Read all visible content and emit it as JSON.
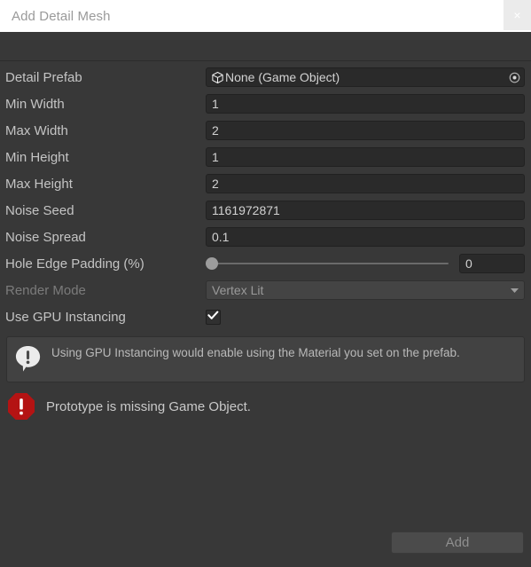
{
  "window": {
    "title": "Add Detail Mesh",
    "close_icon": "close-icon",
    "close_glyph": "×"
  },
  "colors": {
    "titlebar_bg": "#ffffff",
    "body_bg": "#383838",
    "field_bg": "#2a2a2a",
    "label_text": "#c4c4c4",
    "disabled_text": "#7b7b7b",
    "error_red": "#b41313",
    "help_bg": "#424242"
  },
  "form": {
    "rows": [
      {
        "label": "Detail Prefab",
        "control": "object-field",
        "value": "None (Game Object)",
        "icon": "gameobject-cube-icon",
        "picker_icon": "object-picker-icon"
      },
      {
        "label": "Min Width",
        "control": "text-field",
        "value": "1"
      },
      {
        "label": "Max Width",
        "control": "text-field",
        "value": "2"
      },
      {
        "label": "Min Height",
        "control": "text-field",
        "value": "1"
      },
      {
        "label": "Max Height",
        "control": "text-field",
        "value": "2"
      },
      {
        "label": "Noise Seed",
        "control": "text-field",
        "value": "1161972871"
      },
      {
        "label": "Noise Spread",
        "control": "text-field",
        "value": "0.1"
      },
      {
        "label": "Hole Edge Padding (%)",
        "control": "slider",
        "value": "0",
        "slider_min": 0,
        "slider_max": 100,
        "slider_value": 0
      },
      {
        "label": "Render Mode",
        "control": "dropdown",
        "value": "Vertex Lit",
        "disabled": true,
        "arrow_icon": "chevron-down-icon"
      },
      {
        "label": "Use GPU Instancing",
        "control": "checkbox",
        "checked": true,
        "check_icon": "checkmark-icon"
      }
    ]
  },
  "help": {
    "icon": "info-speech-bubble-icon",
    "message": "Using GPU Instancing would enable using the Material you set on the prefab."
  },
  "error": {
    "icon": "error-octagon-icon",
    "message": "Prototype is missing Game Object."
  },
  "footer": {
    "add_label": "Add",
    "add_disabled": true
  }
}
